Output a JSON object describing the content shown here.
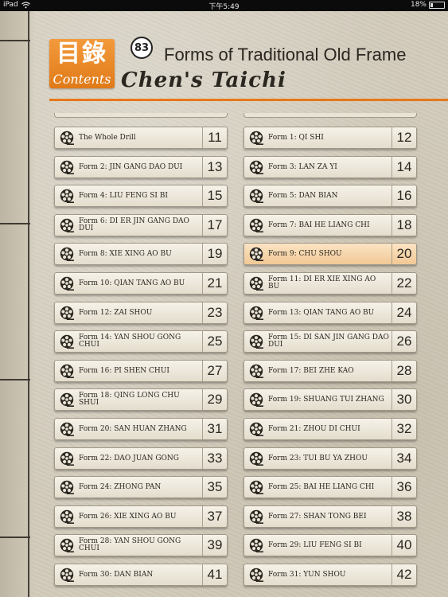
{
  "status_bar": {
    "device": "iPad",
    "time": "下午5:49",
    "battery": "18%"
  },
  "header": {
    "logo_chars": "目錄",
    "logo_contents": "Contents",
    "badge": "83",
    "title_line1": "Forms of Traditional Old Frame",
    "title_line2": "Chen's Taichi"
  },
  "colors": {
    "accent": "#e6781a",
    "highlight": "#f1c895"
  },
  "items": [
    {
      "label": "The Whole Drill",
      "page": "11"
    },
    {
      "label": "Form 1: QI SHI",
      "page": "12"
    },
    {
      "label": "Form 2: JIN GANG DAO DUI",
      "page": "13"
    },
    {
      "label": "Form 3: LAN ZA YI",
      "page": "14"
    },
    {
      "label": "Form 4: LIU FENG SI BI",
      "page": "15"
    },
    {
      "label": "Form 5: DAN BIAN",
      "page": "16"
    },
    {
      "label": "Form 6: DI ER JIN GANG DAO DUI",
      "page": "17"
    },
    {
      "label": "Form 7: BAI HE LIANG CHI",
      "page": "18"
    },
    {
      "label": "Form 8: XIE XING AO BU",
      "page": "19"
    },
    {
      "label": "Form 9: CHU SHOU",
      "page": "20",
      "active": true
    },
    {
      "label": "Form 10: QIAN TANG AO BU",
      "page": "21"
    },
    {
      "label": "Form 11: DI ER XIE XING AO BU",
      "page": "22"
    },
    {
      "label": "Form 12: ZAI SHOU",
      "page": "23"
    },
    {
      "label": "Form 13: QIAN TANG AO BU",
      "page": "24"
    },
    {
      "label": "Form 14: YAN SHOU GONG CHUI",
      "page": "25"
    },
    {
      "label": "Form 15: DI SAN JIN GANG DAO DUI",
      "page": "26"
    },
    {
      "label": "Form 16: PI SHEN CHUI",
      "page": "27"
    },
    {
      "label": "Form 17: BEI ZHE KAO",
      "page": "28"
    },
    {
      "label": "Form 18: QING LONG CHU SHUI",
      "page": "29"
    },
    {
      "label": "Form 19: SHUANG TUI ZHANG",
      "page": "30"
    },
    {
      "label": "Form 20: SAN HUAN ZHANG",
      "page": "31"
    },
    {
      "label": "Form 21: ZHOU DI CHUI",
      "page": "32"
    },
    {
      "label": "Form 22: DAO JUAN GONG",
      "page": "33"
    },
    {
      "label": "Form 23: TUI BU YA ZHOU",
      "page": "34"
    },
    {
      "label": "Form 24: ZHONG PAN",
      "page": "35"
    },
    {
      "label": "Form 25: BAI HE LIANG CHI",
      "page": "36"
    },
    {
      "label": "Form 26: XIE XING AO BU",
      "page": "37"
    },
    {
      "label": "Form 27: SHAN TONG BEI",
      "page": "38"
    },
    {
      "label": "Form 28: YAN SHOU GONG CHUI",
      "page": "39"
    },
    {
      "label": "Form 29: LIU FENG SI BI",
      "page": "40"
    },
    {
      "label": "Form 30: DAN BIAN",
      "page": "41"
    },
    {
      "label": "Form 31: YUN SHOU",
      "page": "42"
    }
  ]
}
